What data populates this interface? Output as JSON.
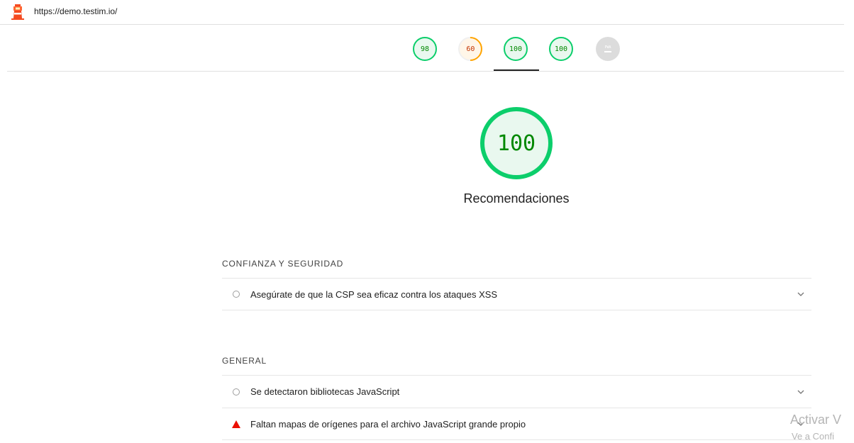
{
  "url": "https://demo.testim.io/",
  "gauges": [
    {
      "score": "98",
      "status": "pass"
    },
    {
      "score": "60",
      "status": "average"
    },
    {
      "score": "100",
      "status": "pass"
    },
    {
      "score": "100",
      "status": "pass"
    },
    {
      "score": "",
      "label": "PWA",
      "status": "na"
    }
  ],
  "selected_tab_index": 2,
  "main": {
    "score": "100",
    "title": "Recomendaciones"
  },
  "sections": [
    {
      "title": "CONFIANZA Y SEGURIDAD",
      "audits": [
        {
          "text": "Asegúrate de que la CSP sea eficaz contra los ataques XSS",
          "status": "informative"
        }
      ]
    },
    {
      "title": "GENERAL",
      "audits": [
        {
          "text": "Se detectaron bibliotecas JavaScript",
          "status": "informative"
        },
        {
          "text": "Faltan mapas de orígenes para el archivo JavaScript grande propio",
          "status": "fail"
        }
      ]
    }
  ],
  "watermark": {
    "line1": "Activar V",
    "line2": "Ve a Confi"
  },
  "colors": {
    "pass": "#0cce6b",
    "average": "#ffa400",
    "fail": "#eb0f00"
  }
}
